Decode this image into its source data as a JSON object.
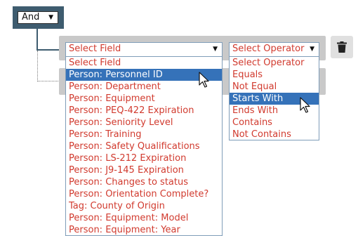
{
  "group": {
    "operator_label": "And"
  },
  "rule1": {
    "field_placeholder": "Select Field",
    "operator_placeholder": "Select Operator"
  },
  "field_options": [
    "Select Field",
    "Person: Personnel ID",
    "Person: Department",
    "Person: Equipment",
    "Person: PEQ-422 Expiration",
    "Person: Seniority Level",
    "Person: Training",
    "Person: Safety Qualifications",
    "Person: LS-212 Expiration",
    "Person: J9-145 Expiration",
    "Person: Changes to status",
    "Person: Orientation Complete?",
    "Tag: County of Origin",
    "Person: Equipment: Model",
    "Person: Equipment: Year"
  ],
  "field_highlighted": "Person: Personnel ID",
  "operator_options": [
    "Select Operator",
    "Equals",
    "Not Equal",
    "Starts With",
    "Ends With",
    "Contains",
    "Not Contains"
  ],
  "operator_highlighted": "Starts With",
  "icons": {
    "delete": "trash-icon",
    "caret": "caret-down-icon",
    "pointer": "mouse-pointer-icon"
  },
  "colors": {
    "group_bg": "#3e5c6f",
    "option_text": "#d13a2e",
    "highlight_bg": "#3572b9",
    "rule_bg": "#c9c9c9"
  }
}
